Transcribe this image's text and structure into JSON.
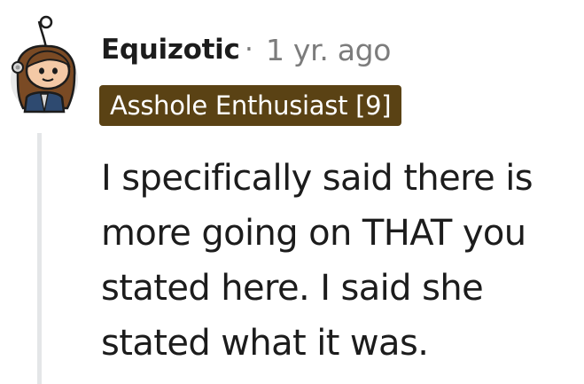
{
  "comment": {
    "author": "Equizotic",
    "separator": "·",
    "timestamp": "1 yr. ago",
    "flair": "Asshole Enthusiast [9]",
    "body_lines": [
      "I specifically said there is",
      "more going on THAT you",
      "stated here. I said she",
      "stated what it was."
    ]
  },
  "colors": {
    "flair_background": "#5a4214",
    "flair_text": "#ffffff",
    "meta_text": "#7c7c7c",
    "body_text": "#1c1c1c",
    "thread_line": "#e4e6e8"
  },
  "icons": {
    "avatar": "snoo-avatar-icon"
  }
}
